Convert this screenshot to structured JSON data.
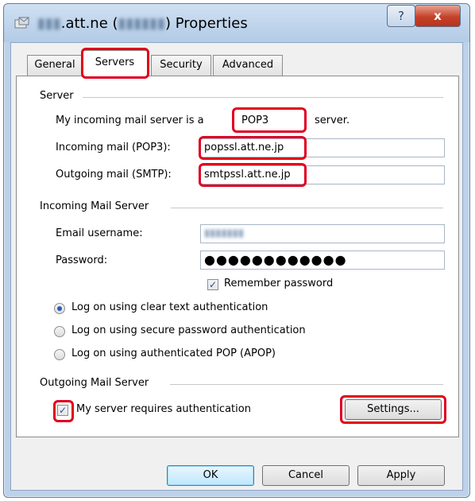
{
  "window": {
    "title_prefix": "▮▮▮",
    "title_domain": ".att.ne (",
    "title_hidden": "▮▮▮▮▮▮",
    "title_suffix": ") Properties",
    "help_glyph": "?",
    "close_glyph": "x"
  },
  "tabs": [
    {
      "label": "General"
    },
    {
      "label": "Servers",
      "active": true
    },
    {
      "label": "Security"
    },
    {
      "label": "Advanced"
    }
  ],
  "server": {
    "section_label": "Server",
    "incoming_type_prefix": "My incoming mail server is a",
    "incoming_type_value": "POP3",
    "incoming_type_suffix": "server.",
    "incoming_label": "Incoming mail (POP3):",
    "incoming_value": "popssl.att.ne.jp",
    "outgoing_label": "Outgoing mail (SMTP):",
    "outgoing_value": "smtpssl.att.ne.jp"
  },
  "incoming_server": {
    "section_label": "Incoming Mail Server",
    "username_label": "Email username:",
    "username_value": "▮▮▮▮▮▮▮",
    "password_label": "Password:",
    "password_value": "●●●●●●●●●●●●",
    "remember_label": "Remember password",
    "auth_options": [
      {
        "label": "Log on using clear text authentication",
        "checked": true
      },
      {
        "label": "Log on using secure password authentication",
        "checked": false
      },
      {
        "label": "Log on using authenticated POP (APOP)",
        "checked": false
      }
    ]
  },
  "outgoing_server": {
    "section_label": "Outgoing Mail Server",
    "requires_auth_label": "My server requires authentication",
    "settings_button": "Settings..."
  },
  "footer": {
    "ok": "OK",
    "cancel": "Cancel",
    "apply": "Apply"
  },
  "colors": {
    "highlight": "#e0001e",
    "checkmark": "#1d4f9c",
    "title_bar": "#bcd2ea"
  }
}
